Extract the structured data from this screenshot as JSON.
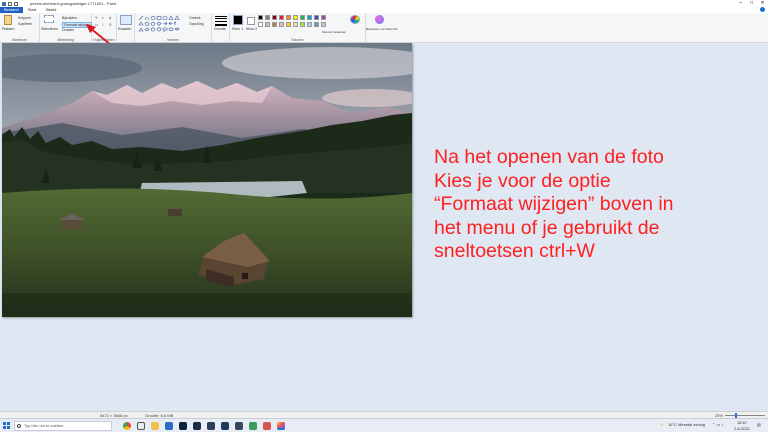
{
  "window": {
    "title": "pexels-eberhard-grossgasteiger-1771001 - Paint",
    "min": "–",
    "max": "□",
    "close": "✕"
  },
  "ribbon_tabs": [
    "Bestand",
    "Start",
    "Beeld"
  ],
  "ribbon": {
    "paste_label": "Plakken",
    "cut_label": "Knippen",
    "copy_label": "Kopiëren",
    "select_label": "Selecteren",
    "crop_label": "Bijsnijden",
    "resize_label": "Formaat wijzigen",
    "rotate_label": "Draaien",
    "brushes_label": "Kwasten",
    "outline_label": "Omtrek",
    "fill_label": "Opvulling",
    "size_label": "Grootte",
    "color1_label": "Kleur 1",
    "color2_label": "Kleur 2",
    "edit_colors_label": "Kleuren bewerken",
    "paint3d_label": "Bewerken met Paint 3D",
    "groups": {
      "clipboard": "Klembord",
      "image": "Afbeelding",
      "tools": "Hulpmiddelen",
      "shapes": "Vormen",
      "colors": "Kleuren"
    },
    "palette": [
      "#000000",
      "#7f7f7f",
      "#880015",
      "#ed1c24",
      "#ff7f27",
      "#fff200",
      "#22b14c",
      "#00a2e8",
      "#3f48cc",
      "#a349a4",
      "#ffffff",
      "#c3c3c3",
      "#b97a57",
      "#ffaec9",
      "#ffc90e",
      "#efe4b0",
      "#b5e61d",
      "#99d9ea",
      "#7092be",
      "#c8bfe7"
    ]
  },
  "note_lines": [
    "Na het openen van de foto",
    "Kies je voor de optie",
    "“Formaat wijzigen” boven in",
    "het menu of je gebruikt de",
    "sneltoetsen ctrl+W"
  ],
  "statusbar": {
    "dimensions": "5472 × 3648 px",
    "filesize": "Grootte: 6,8 MB",
    "zoom": "25%"
  },
  "taskbar": {
    "search_placeholder": "Typ hier om te zoeken",
    "weather": "16°C  Meestal zonnig",
    "time": "16:57",
    "date": "2-6-2021"
  },
  "colors": {
    "note": "#ff2020",
    "arrow": "#e0161d",
    "accent": "#1f5fbf"
  }
}
